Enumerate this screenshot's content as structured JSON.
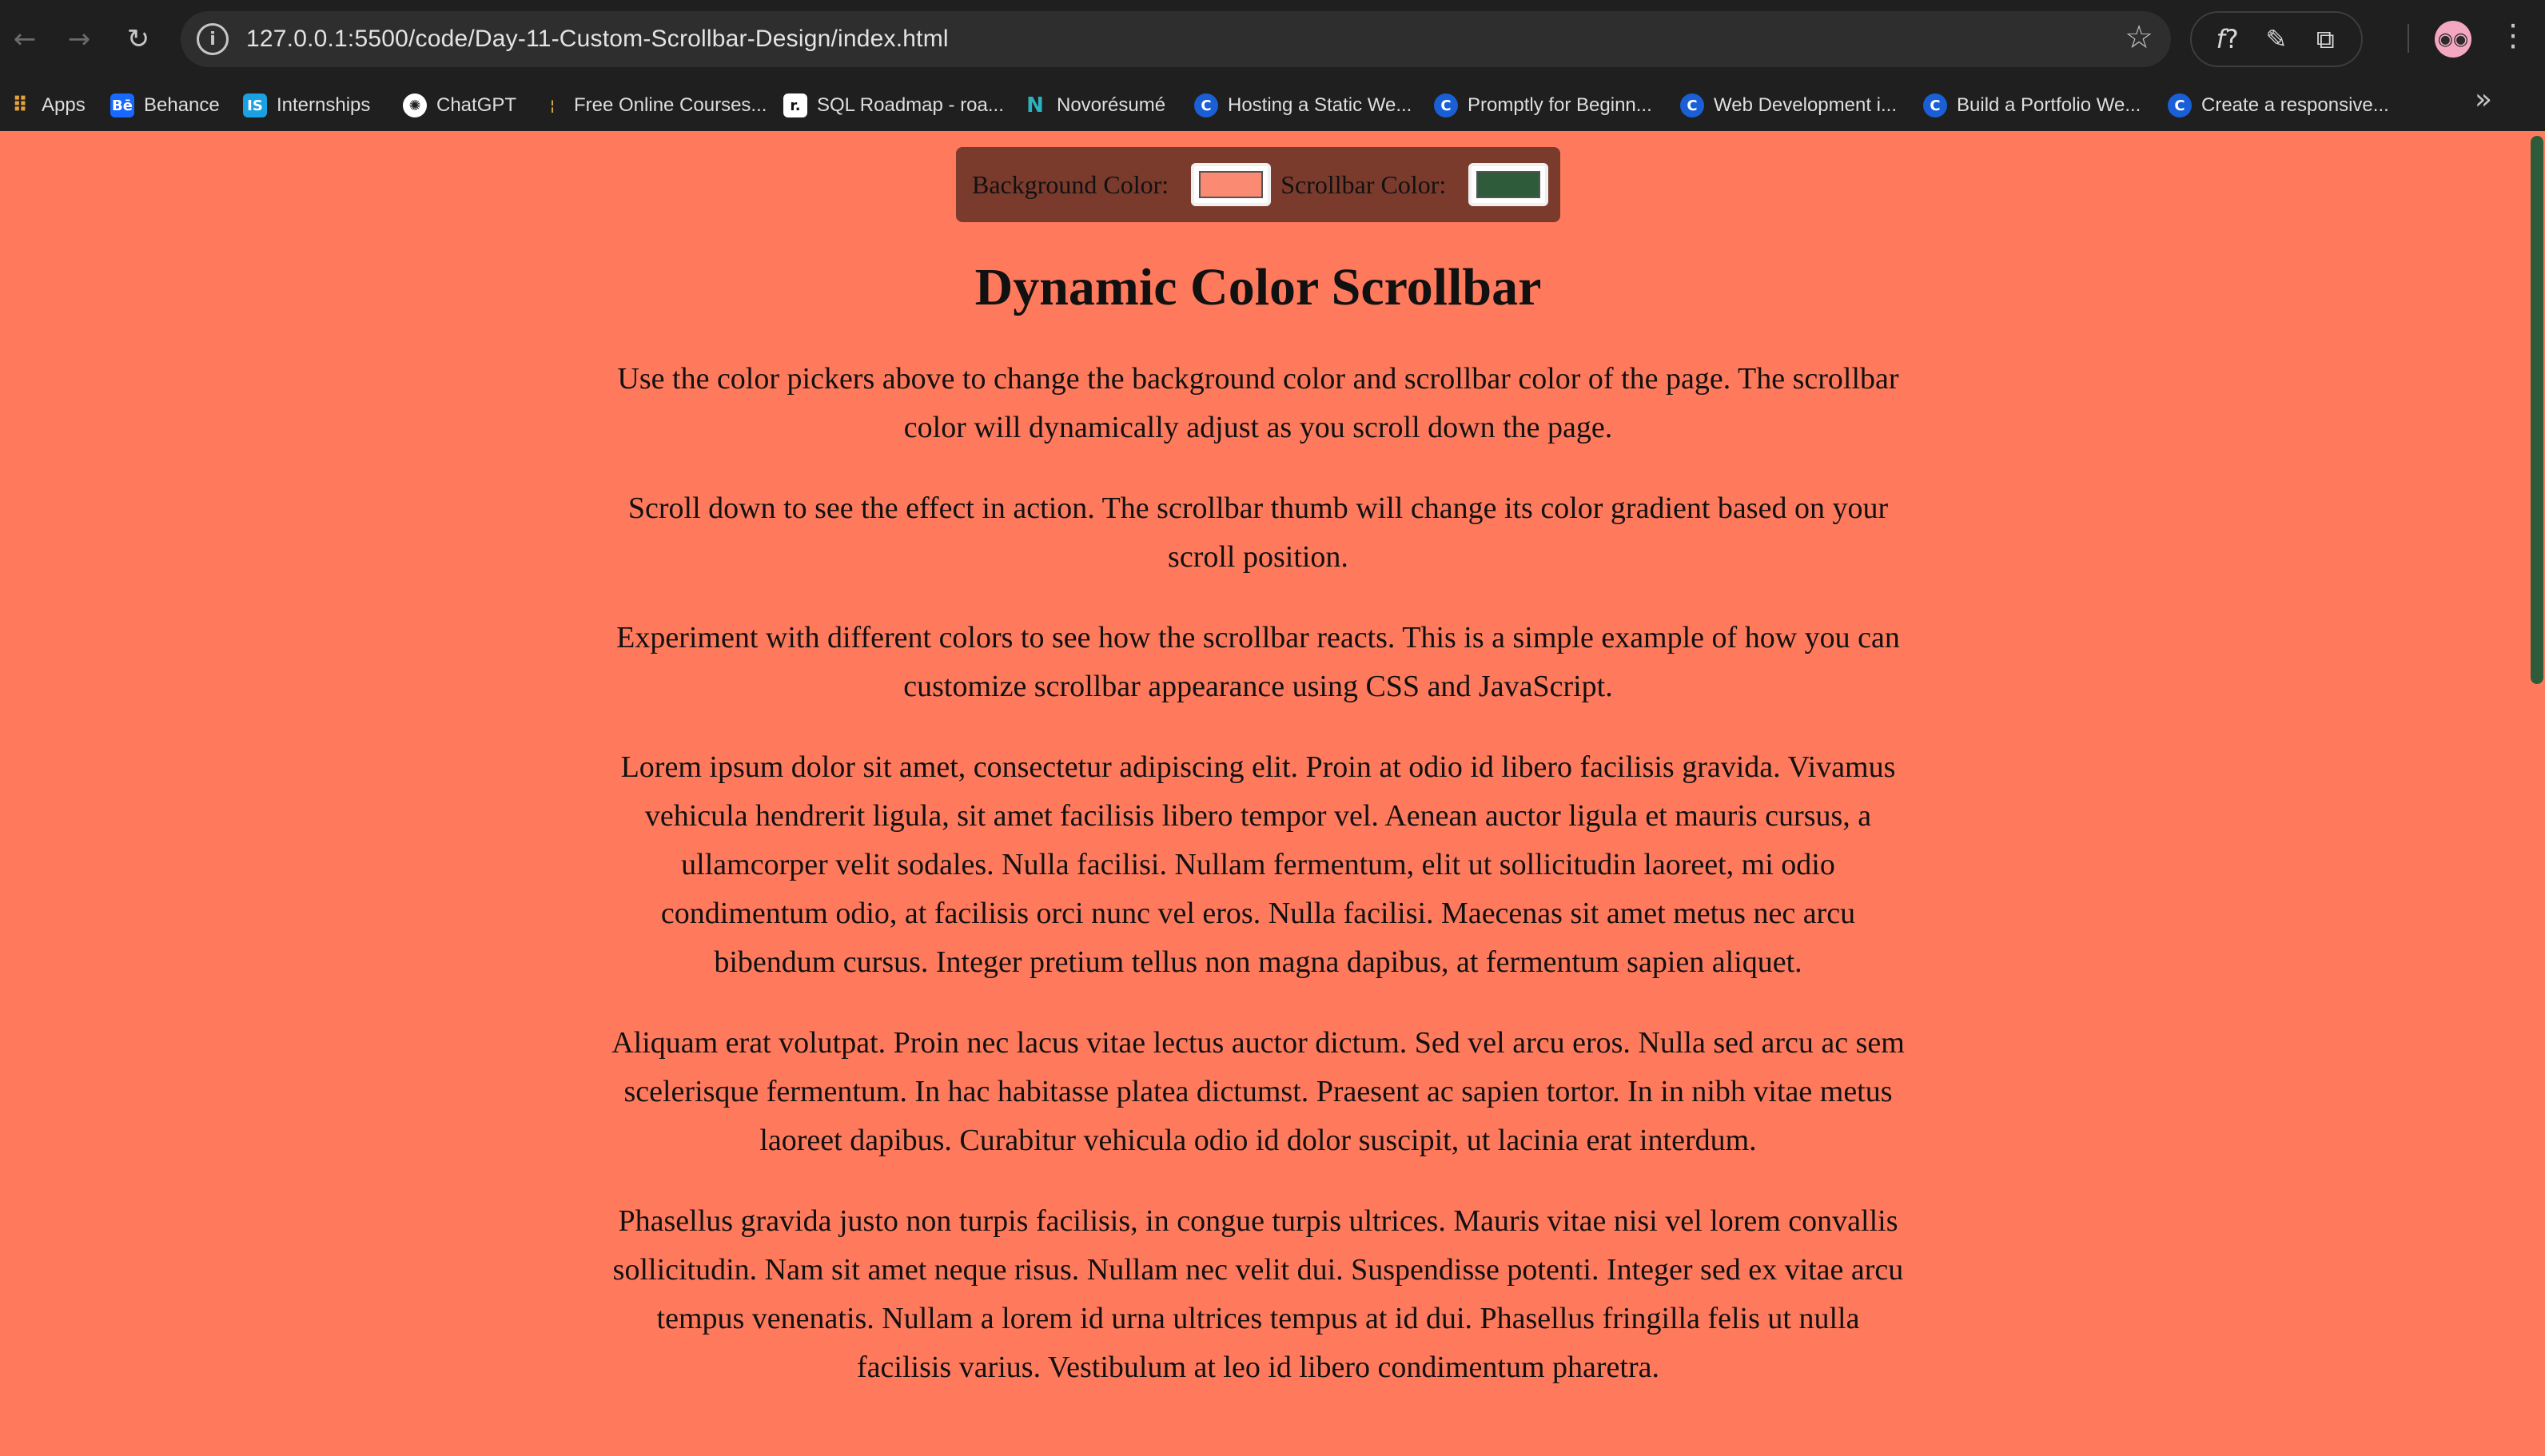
{
  "browser": {
    "url": "127.0.0.1:5500/code/Day-11-Custom-Scrollbar-Design/index.html",
    "bookmarks": [
      {
        "label": "Apps",
        "icon": "apps-grid-icon"
      },
      {
        "label": "Behance",
        "icon": "behance-icon"
      },
      {
        "label": "Internships",
        "icon": "internshala-icon"
      },
      {
        "label": "ChatGPT",
        "icon": "chatgpt-icon"
      },
      {
        "label": "Free Online Courses...",
        "icon": "bookmark-site-icon"
      },
      {
        "label": "SQL Roadmap - roa...",
        "icon": "roadmap-icon"
      },
      {
        "label": "Novorésumé",
        "icon": "novoresume-icon"
      },
      {
        "label": "Hosting a Static We...",
        "icon": "c-site-icon"
      },
      {
        "label": "Promptly for Beginn...",
        "icon": "c-site-icon"
      },
      {
        "label": "Web Development i...",
        "icon": "c-site-icon"
      },
      {
        "label": "Build a Portfolio We...",
        "icon": "c-site-icon"
      },
      {
        "label": "Create a responsive...",
        "icon": "c-site-icon"
      }
    ]
  },
  "page": {
    "background_color": "#ff7a5c",
    "controls": {
      "background_label": "Background Color:",
      "background_value": "#fa8a72",
      "scrollbar_label": "Scrollbar Color:",
      "scrollbar_value": "#2e5b3a"
    },
    "title": "Dynamic Color Scrollbar",
    "paragraphs": [
      "Use the color pickers above to change the background color and scrollbar color of the page. The scrollbar color will dynamically adjust as you scroll down the page.",
      "Scroll down to see the effect in action. The scrollbar thumb will change its color gradient based on your scroll position.",
      "Experiment with different colors to see how the scrollbar reacts. This is a simple example of how you can customize scrollbar appearance using CSS and JavaScript.",
      "Lorem ipsum dolor sit amet, consectetur adipiscing elit. Proin at odio id libero facilisis gravida. Vivamus vehicula hendrerit ligula, sit amet facilisis libero tempor vel. Aenean auctor ligula et mauris cursus, a ullamcorper velit sodales. Nulla facilisi. Nullam fermentum, elit ut sollicitudin laoreet, mi odio condimentum odio, at facilisis orci nunc vel eros. Nulla facilisi. Maecenas sit amet metus nec arcu bibendum cursus. Integer pretium tellus non magna dapibus, at fermentum sapien aliquet.",
      "Aliquam erat volutpat. Proin nec lacus vitae lectus auctor dictum. Sed vel arcu eros. Nulla sed arcu ac sem scelerisque fermentum. In hac habitasse platea dictumst. Praesent ac sapien tortor. In in nibh vitae metus laoreet dapibus. Curabitur vehicula odio id dolor suscipit, ut lacinia erat interdum.",
      "Phasellus gravida justo non turpis facilisis, in congue turpis ultrices. Mauris vitae nisi vel lorem convallis sollicitudin. Nam sit amet neque risus. Nullam nec velit dui. Suspendisse potenti. Integer sed ex vitae arcu tempus venenatis. Nullam a lorem id urna ultrices tempus at id dui. Phasellus fringilla felis ut nulla facilisis varius. Vestibulum at leo id libero condimentum pharetra."
    ]
  }
}
